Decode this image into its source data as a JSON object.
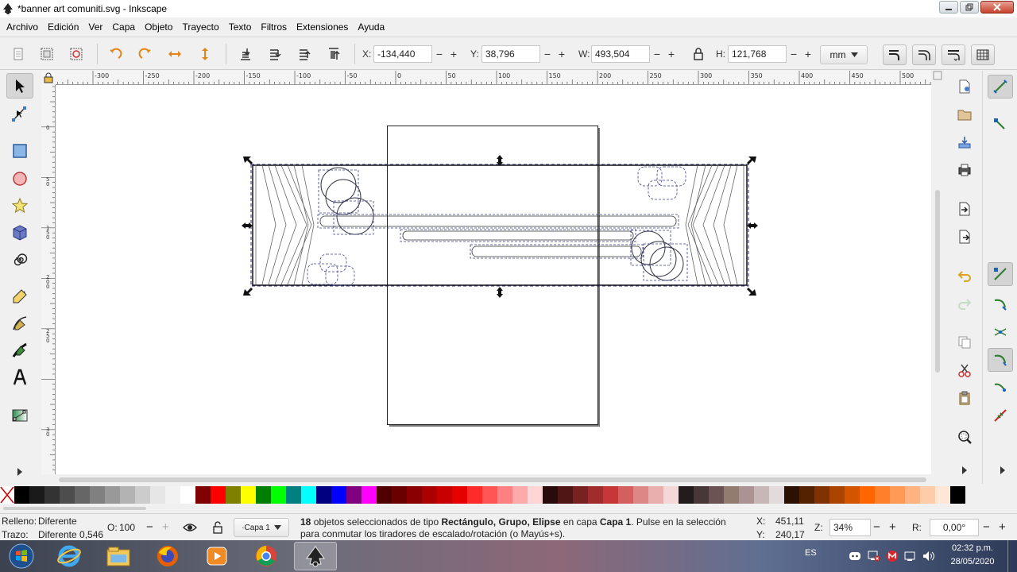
{
  "window": {
    "title": "*banner art comuniti.svg - Inkscape"
  },
  "menu": [
    "Archivo",
    "Edición",
    "Ver",
    "Capa",
    "Objeto",
    "Trayecto",
    "Texto",
    "Filtros",
    "Extensiones",
    "Ayuda"
  ],
  "controls": {
    "x_label": "X:",
    "x_value": "-134,440",
    "y_label": "Y:",
    "y_value": "38,796",
    "w_label": "W:",
    "w_value": "493,504",
    "h_label": "H:",
    "h_value": "121,768",
    "unit": "mm",
    "minus": "−",
    "plus": "+"
  },
  "ruler": {
    "h_labels": [
      "-300",
      "-250",
      "-200",
      "-150",
      "-100",
      "-50",
      "0",
      "50",
      "100",
      "150",
      "200",
      "250",
      "300",
      "350",
      "400",
      "450",
      "500"
    ],
    "v_labels": [
      "0",
      "5",
      "0",
      "1",
      "5",
      "0",
      "2",
      "0",
      "0",
      "2",
      "5",
      "0",
      "3",
      "0"
    ]
  },
  "status": {
    "fill_label": "Relleno:",
    "fill_value": "Diferente",
    "stroke_label": "Trazo:",
    "stroke_value": "Diferente 0,546",
    "opacity_label": "O:",
    "opacity_value": "100",
    "layer": "·Capa 1",
    "message_count": "18",
    "message_part1": " objetos seleccionados de tipo ",
    "message_types": "Rectángulo, Grupo, Elipse",
    "message_part2": " en capa ",
    "message_layer": "Capa 1",
    "message_part3": ". Pulse en la selección",
    "message_line2": "para conmutar los tiradores de escalado/rotación (o Mayús+s).",
    "cursor_x_label": "X:",
    "cursor_x": "451,11",
    "cursor_y_label": "Y:",
    "cursor_y": "240,17",
    "zoom_label": "Z:",
    "zoom": "34%",
    "rotation_label": "R:",
    "rotation": "0,00°"
  },
  "palette": [
    "#000000",
    "#1a1a1a",
    "#333333",
    "#4d4d4d",
    "#666666",
    "#808080",
    "#999999",
    "#b3b3b3",
    "#cccccc",
    "#e6e6e6",
    "#f2f2f2",
    "#ffffff",
    "#800000",
    "#ff0000",
    "#808000",
    "#ffff00",
    "#008000",
    "#00ff00",
    "#008080",
    "#00ffff",
    "#000080",
    "#0000ff",
    "#800080",
    "#ff00ff",
    "#500000",
    "#6b0000",
    "#8a0000",
    "#aa0000",
    "#c80000",
    "#e60000",
    "#ff2a2a",
    "#ff5555",
    "#ff8080",
    "#ffaaaa",
    "#ffd5d5",
    "#280b0b",
    "#501616",
    "#782121",
    "#a02c2c",
    "#c83737",
    "#d35f5f",
    "#de8787",
    "#e9afaf",
    "#f4d7d7",
    "#241c1c",
    "#483737",
    "#6c5353",
    "#917c6f",
    "#ac9393",
    "#c8b7b7",
    "#e3dbdb",
    "#2b1100",
    "#552200",
    "#803300",
    "#aa4400",
    "#d45500",
    "#ff6600",
    "#ff7f2a",
    "#ff9955",
    "#ffb380",
    "#ffccaa",
    "#ffe6d5",
    "#000000"
  ],
  "taskbar": {
    "lang": "ES",
    "time": "02:32 p.m.",
    "date": "28/05/2020"
  }
}
